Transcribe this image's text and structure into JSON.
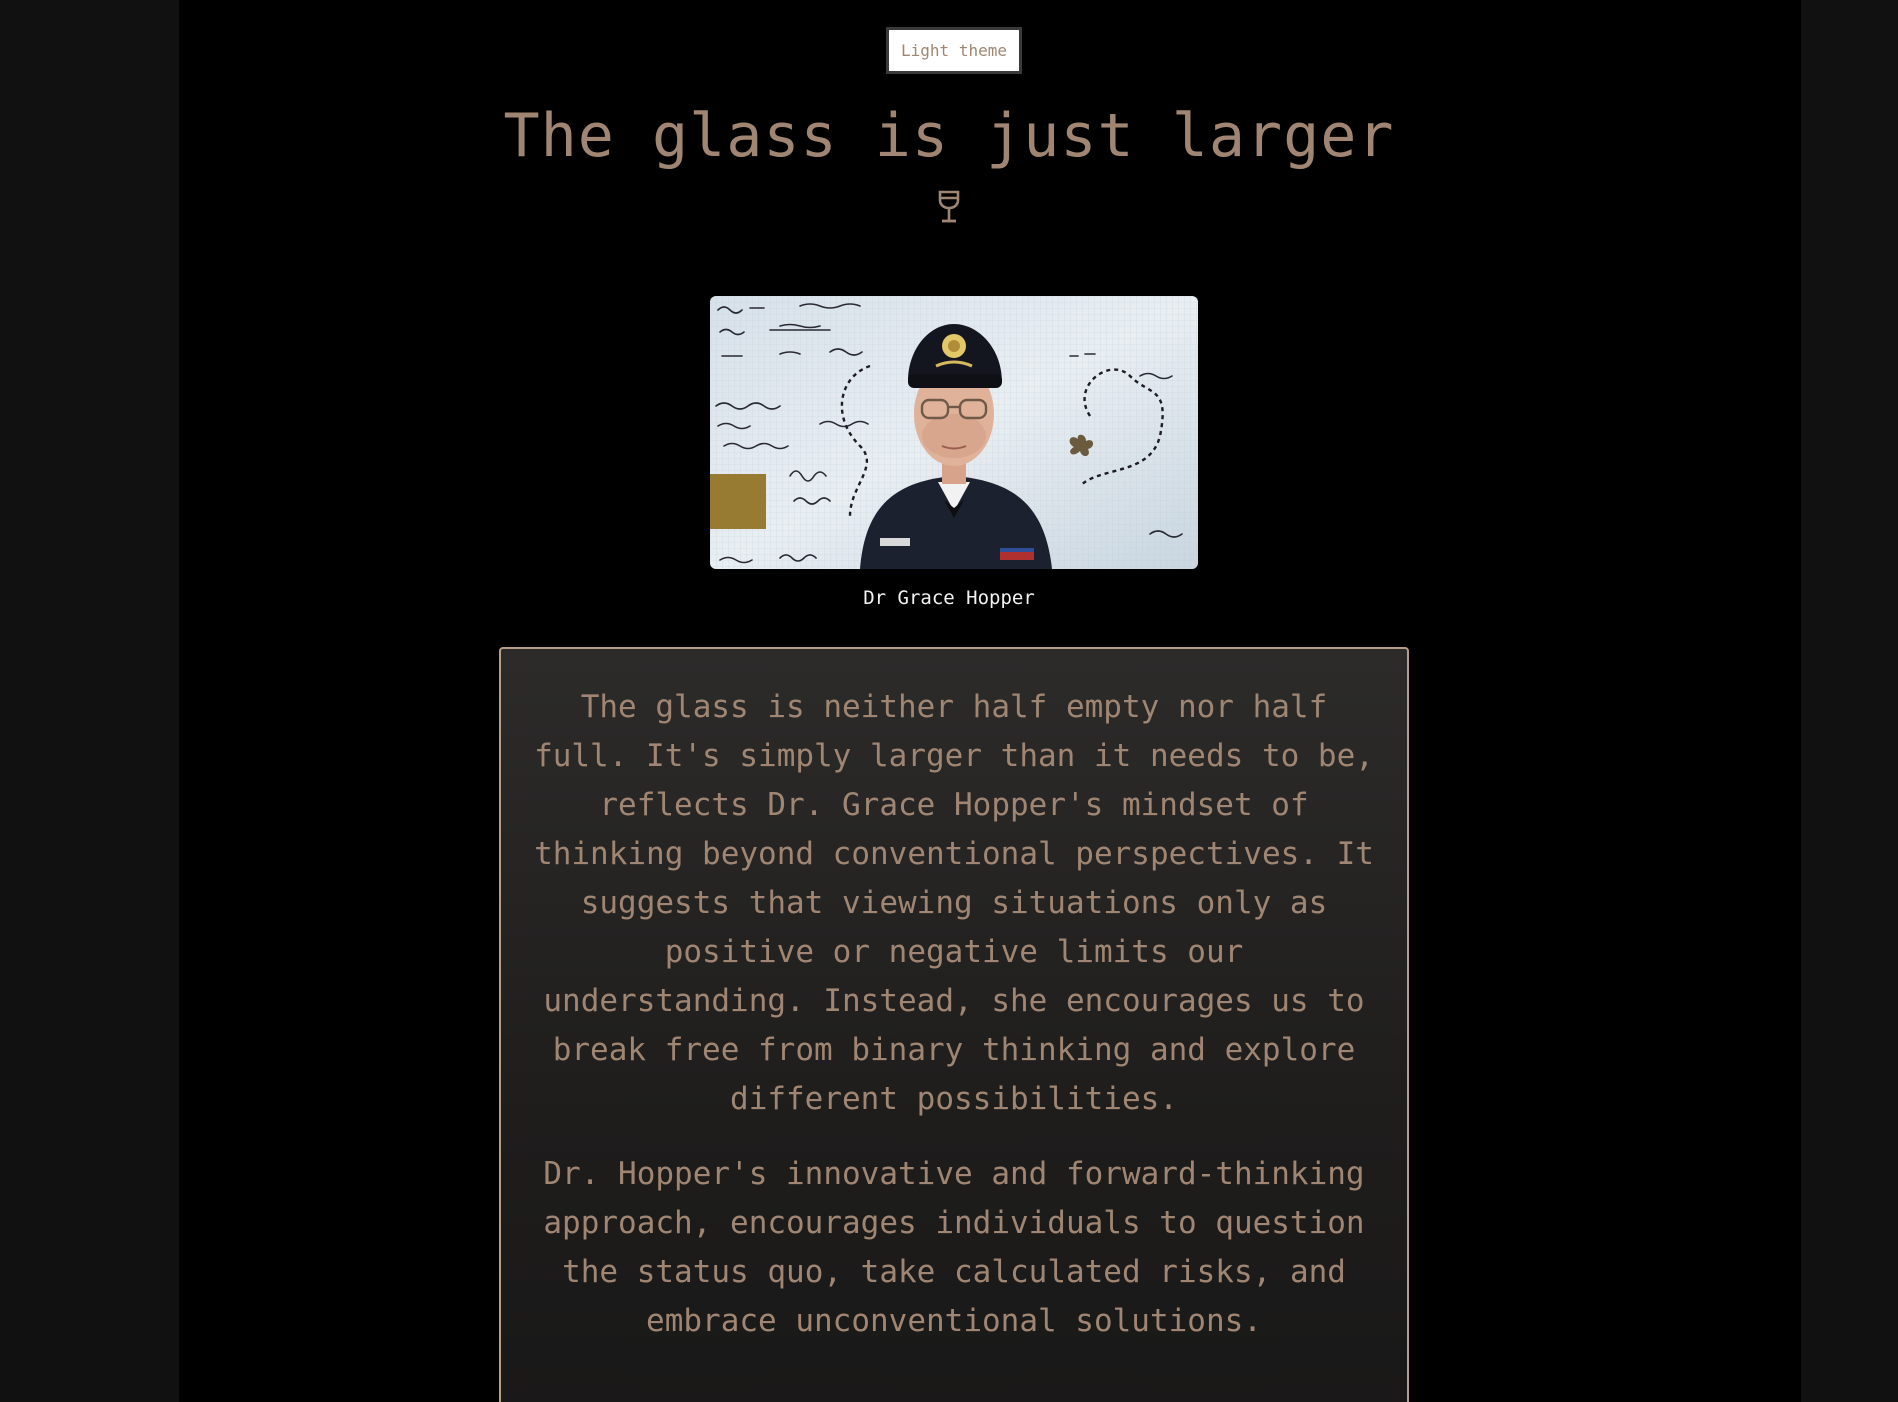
{
  "theme_toggle": {
    "label": "Light theme"
  },
  "header": {
    "title": "The glass is just larger",
    "icon": "wine-glass-icon"
  },
  "portrait": {
    "caption": "Dr Grace Hopper",
    "icon": "portrait-photo"
  },
  "quote": {
    "paragraphs": [
      "The glass is neither half empty nor half full. It's simply larger than it needs to be, reflects Dr. Grace Hopper's mindset of thinking beyond conventional perspectives. It suggests that viewing situations only as positive or negative limits our understanding. Instead, she encourages us to break free from binary thinking and explore different possibilities.",
      "Dr. Hopper's innovative and forward-thinking approach, encourages individuals to question the status quo, take calculated risks, and embrace unconventional solutions."
    ]
  },
  "colors": {
    "accent_text": "#a08672",
    "border": "#b89d86",
    "page_background": "#000000",
    "outer_background": "#111111"
  }
}
